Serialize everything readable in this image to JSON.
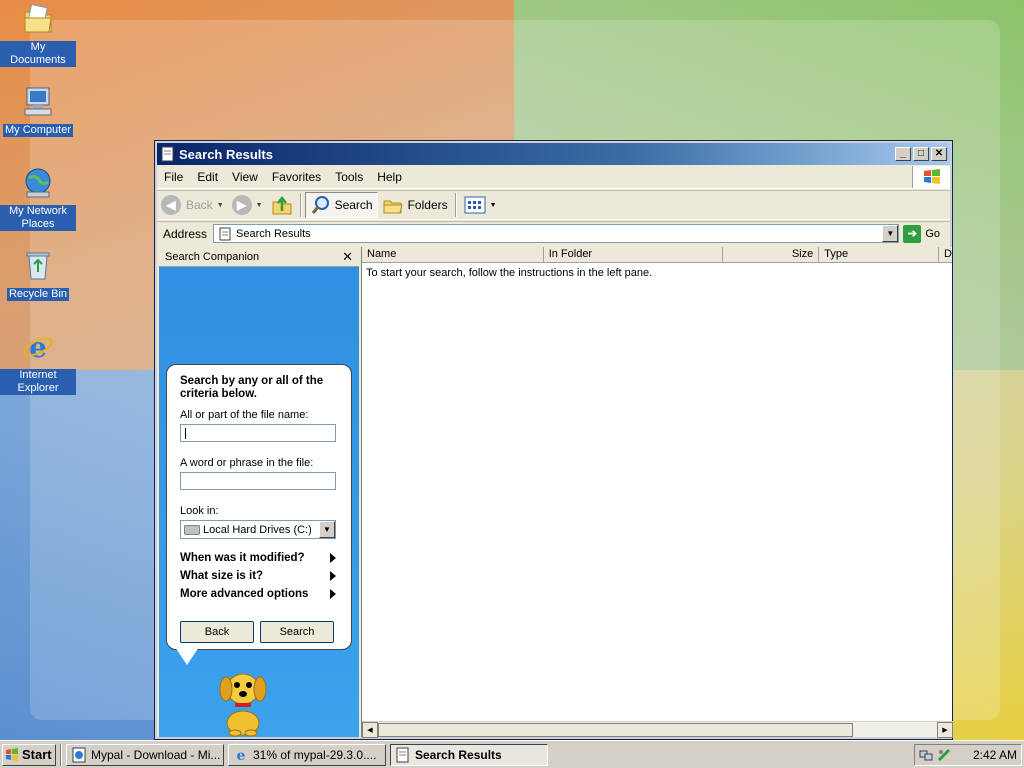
{
  "desktop": {
    "icons": [
      {
        "label": "My Documents"
      },
      {
        "label": "My Computer"
      },
      {
        "label": "My Network Places"
      },
      {
        "label": "Recycle Bin"
      },
      {
        "label": "Internet Explorer"
      }
    ]
  },
  "window": {
    "title": "Search Results",
    "menu": [
      "File",
      "Edit",
      "View",
      "Favorites",
      "Tools",
      "Help"
    ],
    "toolbar": {
      "back": "Back",
      "search": "Search",
      "folders": "Folders"
    },
    "address": {
      "label": "Address",
      "value": "Search Results",
      "go": "Go"
    },
    "left_pane": {
      "header": "Search Companion",
      "heading": "Search by any or all of the criteria below.",
      "file_name_label": "All or part of the file name:",
      "file_name_value": "",
      "phrase_label": "A word or phrase in the file:",
      "phrase_value": "",
      "look_in_label": "Look in:",
      "look_in_value": "Local Hard Drives (C:)",
      "expanders": [
        "When was it modified?",
        "What size is it?",
        "More advanced options"
      ],
      "back_button": "Back",
      "search_button": "Search"
    },
    "right_pane": {
      "columns": [
        "Name",
        "In Folder",
        "Size",
        "Type",
        "D"
      ],
      "message": "To start your search, follow the instructions in the left pane."
    }
  },
  "taskbar": {
    "start": "Start",
    "tasks": [
      {
        "label": "Mypal - Download - Mi..."
      },
      {
        "label": "31% of mypal-29.3.0...."
      },
      {
        "label": "Search Results"
      }
    ],
    "clock": "2:42 AM"
  },
  "colors": {
    "titlebar": "#0a246a",
    "left_pane": "#3399e6",
    "chrome": "#ece9d8"
  }
}
